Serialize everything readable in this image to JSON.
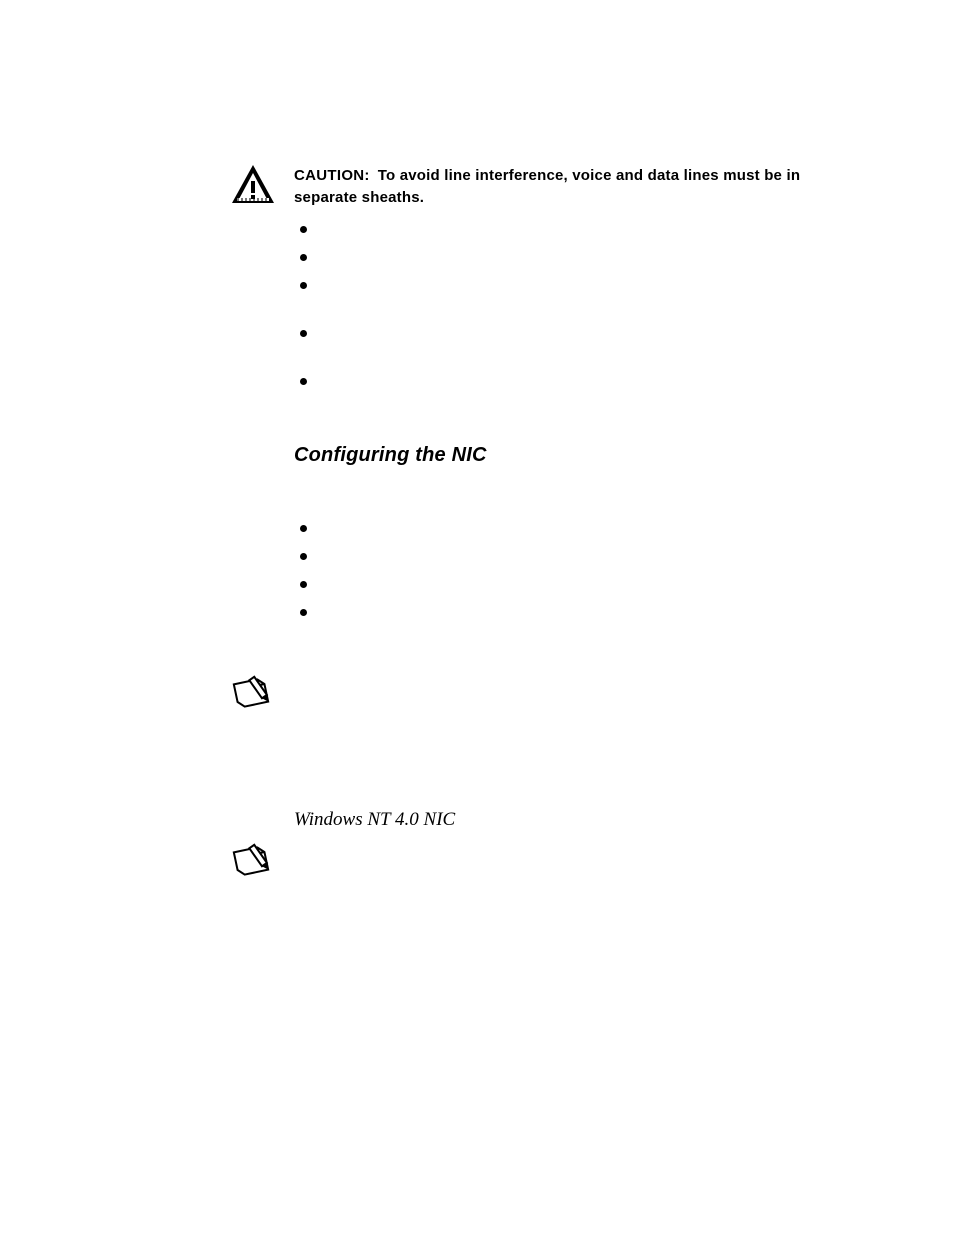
{
  "caution": {
    "label": "CAUTION:",
    "text": "To avoid line interference, voice and data lines must be in separate sheaths."
  },
  "bullets_top": [
    "",
    "",
    "",
    "",
    ""
  ],
  "heading": "Configuring the NIC",
  "bullets_mid": [
    "",
    "",
    "",
    ""
  ],
  "subheading": "Windows NT 4.0 NIC",
  "icons": {
    "caution": "caution-triangle",
    "note": "pencil-note"
  }
}
